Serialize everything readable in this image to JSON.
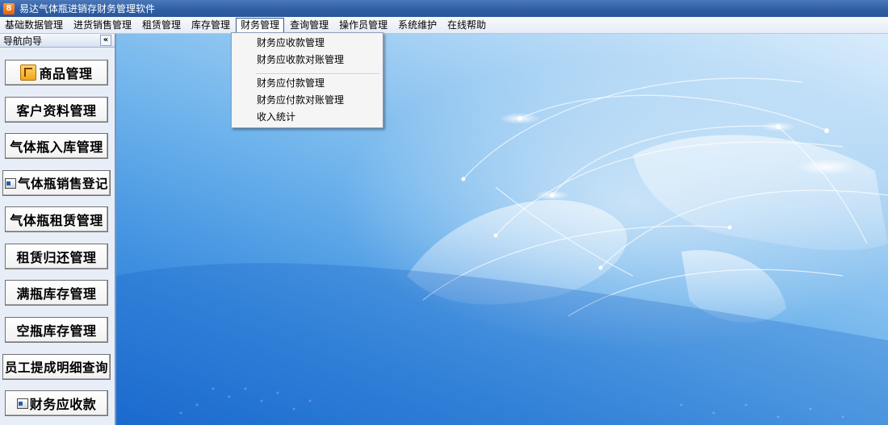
{
  "window": {
    "title": "易达气体瓶进销存财务管理软件",
    "icon_text": "8"
  },
  "menubar": {
    "items": [
      "基础数据管理",
      "进货销售管理",
      "租赁管理",
      "库存管理",
      "财务管理",
      "查询管理",
      "操作员管理",
      "系统维护",
      "在线帮助"
    ],
    "active_index": 4
  },
  "dropdown": {
    "items": [
      "财务应收款管理",
      "财务应收款对账管理",
      "财务应付款管理",
      "财务应付款对账管理",
      "收入统计"
    ]
  },
  "sidebar": {
    "title": "导航向导",
    "collapse_label": "«",
    "buttons": [
      "商品管理",
      "客户资料管理",
      "气体瓶入库管理",
      "气体瓶销售登记",
      "气体瓶租赁管理",
      "租赁归还管理",
      "满瓶库存管理",
      "空瓶库存管理",
      "员工提成明细查询",
      "财务应收款"
    ]
  },
  "colors": {
    "titlebar": "#2f5fa4",
    "main_background": "#3e8fe0",
    "sidebar_background": "#e8eef8"
  }
}
